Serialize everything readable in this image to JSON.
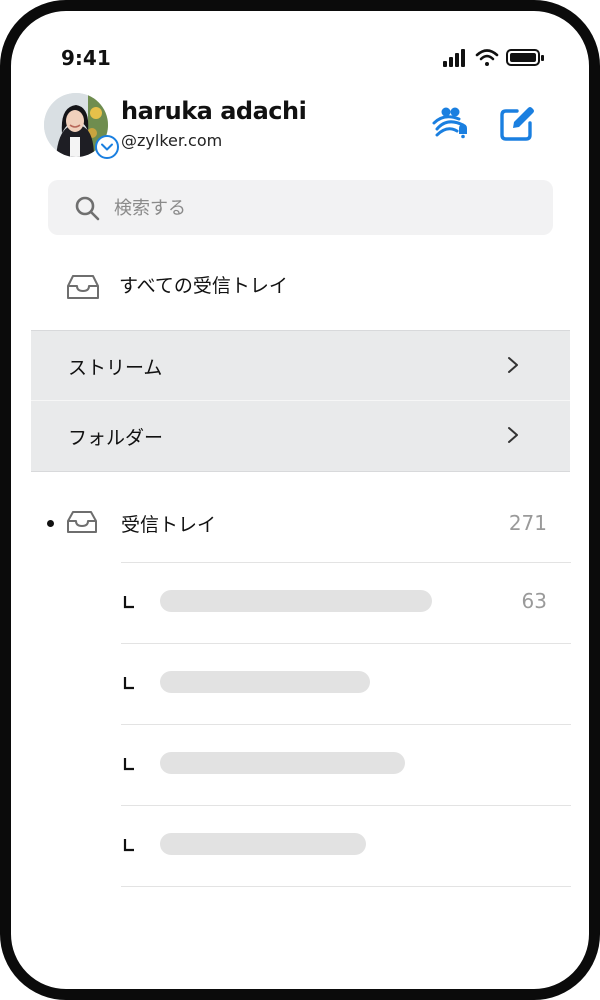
{
  "status_bar": {
    "time": "9:41"
  },
  "profile": {
    "name": "haruka adachi",
    "email": "@zylker.com"
  },
  "search": {
    "placeholder": "検索する"
  },
  "all_inboxes": {
    "label": "すべての受信トレイ"
  },
  "nav": [
    {
      "label": "ストリーム"
    },
    {
      "label": "フォルダー"
    }
  ],
  "inbox": {
    "label": "受信トレイ",
    "count": "271"
  },
  "subfolders": [
    {
      "count": "63"
    },
    {
      "count": ""
    },
    {
      "count": ""
    },
    {
      "count": ""
    }
  ],
  "colors": {
    "accent": "#1a7fe0",
    "nav_background": "#e9eaeb",
    "search_background": "#f2f2f3",
    "placeholder_bar": "#e2e2e2",
    "count_text": "#9a9a9a"
  },
  "icons": {
    "contacts": "contacts-bell-icon",
    "compose": "compose-icon",
    "search": "search-icon",
    "inbox": "inbox-tray-icon",
    "chevron": "chevron-right-icon"
  }
}
